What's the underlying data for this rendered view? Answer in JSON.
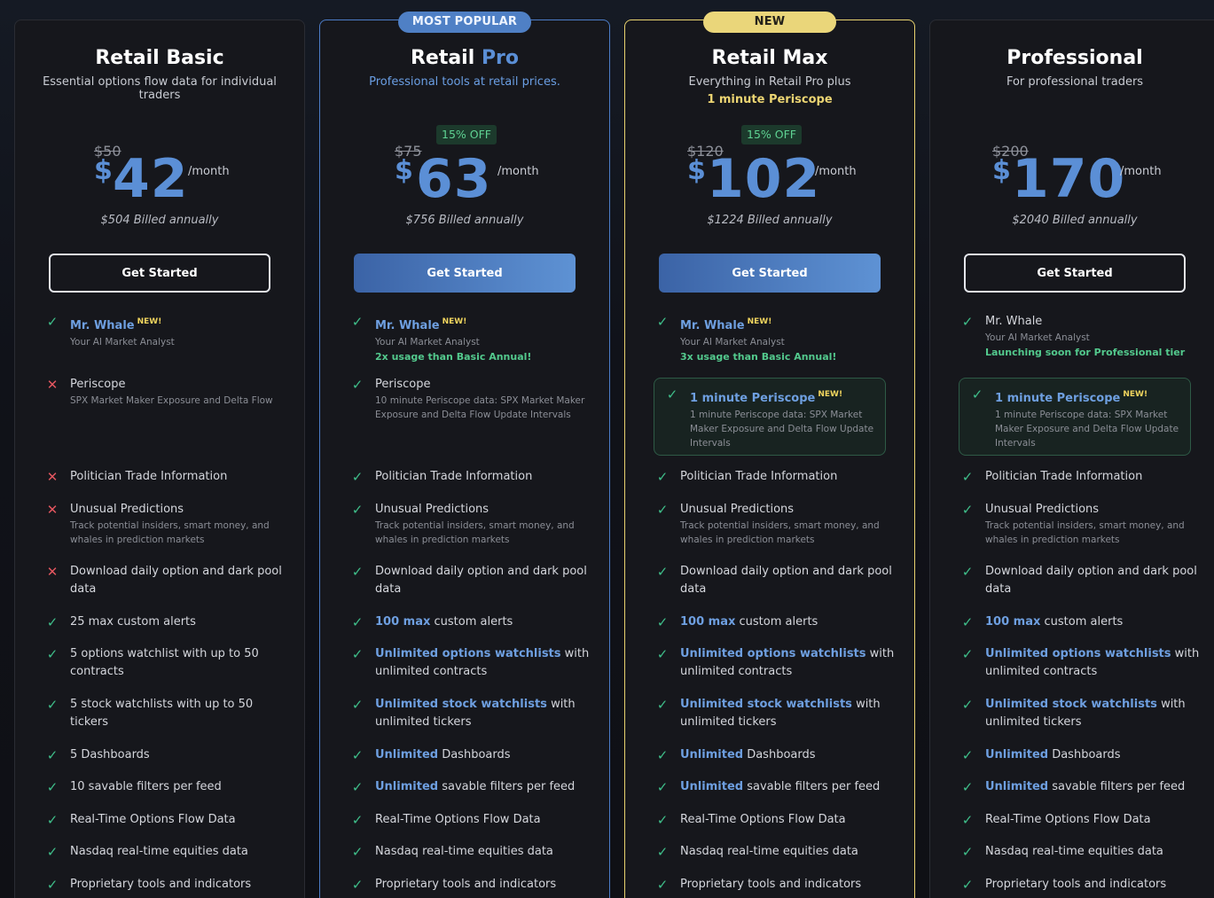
{
  "plans": [
    {
      "title": "Retail Basic",
      "subtitle": "Essential options flow data for individual traders",
      "old_price": "$50",
      "dollar": "$",
      "price": "42",
      "per": "/month",
      "billed": "$504 Billed annually",
      "cta": "Get Started",
      "f": {
        "whale": "Mr. Whale",
        "new": "NEW!",
        "whale_desc": "Your AI Market Analyst",
        "periscope": "Periscope",
        "periscope_desc": "SPX Market Maker Exposure and Delta Flow",
        "politician": "Politician Trade Information",
        "unusual": "Unusual Predictions",
        "unusual_desc_1": "Track potential insiders, smart money, and",
        "unusual_desc_2": "whales in prediction markets",
        "download_1": "Download daily option and dark pool",
        "download_2": "data",
        "alerts": "25 max custom alerts",
        "opt_1": "5 options watchlist with up to 50",
        "opt_2": "contracts",
        "stk_1": "5 stock watchlists with up to 50",
        "stk_2": "tickers",
        "dash": "5 Dashboards",
        "filters": "10 savable filters per feed",
        "rt": "Real-Time Options Flow Data",
        "nasdaq": "Nasdaq real-time equities data",
        "prop": "Proprietary tools and indicators"
      }
    },
    {
      "title_a": "Retail",
      "title_b": "Pro",
      "ribbon": "MOST POPULAR",
      "subtitle": "Professional tools at retail prices.",
      "discount": "15% OFF",
      "old_price": "$75",
      "dollar": "$",
      "price": "63",
      "per": "/month",
      "billed": "$756 Billed annually",
      "cta": "Get Started",
      "f": {
        "whale": "Mr. Whale",
        "new": "NEW!",
        "whale_desc": "Your AI Market Analyst",
        "whale_note": "2x usage than Basic Annual!",
        "periscope": "Periscope",
        "periscope_desc_1": "10 minute Periscope data: SPX Market Maker",
        "periscope_desc_2": "Exposure and Delta Flow Update Intervals",
        "politician": "Politician Trade Information",
        "unusual": "Unusual Predictions",
        "unusual_desc_1": "Track potential insiders, smart money, and",
        "unusual_desc_2": "whales in prediction markets",
        "download_1": "Download daily option and dark pool",
        "download_2": "data",
        "alerts_hl": "100 max",
        "alerts_rest": "custom alerts",
        "opt_hl": "Unlimited options watchlists",
        "opt_rest": "with",
        "opt_2": "unlimited contracts",
        "stk_hl": "Unlimited stock watchlists",
        "stk_rest": "with",
        "stk_2": "unlimited tickers",
        "dash_hl": "Unlimited",
        "dash_rest": "Dashboards",
        "filters_hl": "Unlimited",
        "filters_rest": "savable filters per feed",
        "rt": "Real-Time Options Flow Data",
        "nasdaq": "Nasdaq real-time equities data",
        "prop": "Proprietary tools and indicators"
      }
    },
    {
      "title": "Retail Max",
      "ribbon": "NEW",
      "subtitle": "Everything in Retail Pro plus",
      "subtitle2": "1 minute Periscope",
      "discount": "15% OFF",
      "old_price": "$120",
      "dollar": "$",
      "price": "102",
      "per": "/month",
      "billed": "$1224 Billed annually",
      "cta": "Get Started",
      "f": {
        "whale": "Mr. Whale",
        "new": "NEW!",
        "whale_desc": "Your AI Market Analyst",
        "whale_note": "3x usage than Basic Annual!",
        "periscope": "1 minute Periscope",
        "periscope_desc_1": "1 minute Periscope data: SPX Market",
        "periscope_desc_2": "Maker Exposure and Delta Flow Update",
        "periscope_desc_3": "Intervals",
        "politician": "Politician Trade Information",
        "unusual": "Unusual Predictions",
        "unusual_desc_1": "Track potential insiders, smart money, and",
        "unusual_desc_2": "whales in prediction markets",
        "download_1": "Download daily option and dark pool",
        "download_2": "data",
        "alerts_hl": "100 max",
        "alerts_rest": "custom alerts",
        "opt_hl": "Unlimited options watchlists",
        "opt_rest": "with",
        "opt_2": "unlimited contracts",
        "stk_hl": "Unlimited stock watchlists",
        "stk_rest": "with",
        "stk_2": "unlimited tickers",
        "dash_hl": "Unlimited",
        "dash_rest": "Dashboards",
        "filters_hl": "Unlimited",
        "filters_rest": "savable filters per feed",
        "rt": "Real-Time Options Flow Data",
        "nasdaq": "Nasdaq real-time equities data",
        "prop": "Proprietary tools and indicators"
      }
    },
    {
      "title": "Professional",
      "subtitle": "For professional traders",
      "old_price": "$200",
      "dollar": "$",
      "price": "170",
      "per": "/month",
      "billed": "$2040 Billed annually",
      "cta": "Get Started",
      "f": {
        "whale": "Mr. Whale",
        "whale_desc": "Your AI Market Analyst",
        "whale_note": "Launching soon for Professional tier",
        "new": "NEW!",
        "periscope": "1 minute Periscope",
        "periscope_desc_1": "1 minute Periscope data: SPX Market",
        "periscope_desc_2": "Maker Exposure and Delta Flow Update",
        "periscope_desc_3": "Intervals",
        "politician": "Politician Trade Information",
        "unusual": "Unusual Predictions",
        "unusual_desc_1": "Track potential insiders, smart money, and",
        "unusual_desc_2": "whales in prediction markets",
        "download_1": "Download daily option and dark pool",
        "download_2": "data",
        "alerts_hl": "100 max",
        "alerts_rest": "custom alerts",
        "opt_hl": "Unlimited options watchlists",
        "opt_rest": "with",
        "opt_2": "unlimited contracts",
        "stk_hl": "Unlimited stock watchlists",
        "stk_rest": "with",
        "stk_2": "unlimited tickers",
        "dash_hl": "Unlimited",
        "dash_rest": "Dashboards",
        "filters_hl": "Unlimited",
        "filters_rest": "savable filters per feed",
        "rt": "Real-Time Options Flow Data",
        "nasdaq": "Nasdaq real-time equities data",
        "prop": "Proprietary tools and indicators"
      }
    }
  ],
  "icons": {
    "check": "check-icon",
    "cross": "cross-icon"
  },
  "colors": {
    "accent": "#5b8fd6",
    "check": "#3fbf8a",
    "cross": "#e3565f",
    "new_badge": "#f0d45e",
    "popular": "#4f80c5",
    "new_ribbon": "#ead67a"
  }
}
